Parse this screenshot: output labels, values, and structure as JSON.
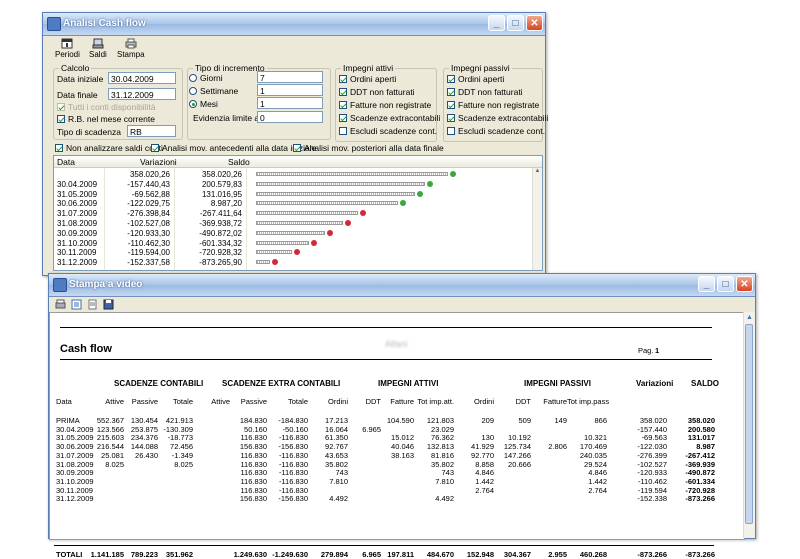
{
  "cashflow_window": {
    "title": "Analisi Cash flow",
    "toolbar": [
      {
        "label": "Periodi",
        "icon": "calendar-icon"
      },
      {
        "label": "Saldi",
        "icon": "scales-icon"
      },
      {
        "label": "Stampa",
        "icon": "printer-icon"
      }
    ],
    "calcolo": {
      "title": "Calcolo",
      "data_iniziale_label": "Data iniziale",
      "data_iniziale": "30.04.2009",
      "data_finale_label": "Data finale",
      "data_finale": "31.12.2009",
      "tutti_conti_label": "Tutti i conti disponibilità",
      "rb_label": "R.B. nel mese corrente",
      "tipo_scadenza_label": "Tipo di scadenza",
      "tipo_scadenza": "RB"
    },
    "incremento": {
      "title": "Tipo di incremento",
      "giorni_label": "Giorni",
      "giorni_value": "7",
      "settimane_label": "Settimane",
      "settimane_value": "1",
      "mesi_label": "Mesi",
      "mesi_value": "1",
      "evidenzia_label": "Evidenzia limite a",
      "evidenzia_value": "0"
    },
    "impegni_attivi": {
      "title": "Impegni attivi",
      "items": [
        {
          "label": "Ordini aperti",
          "checked": true
        },
        {
          "label": "DDT non fatturati",
          "checked": true
        },
        {
          "label": "Fatture non registrate",
          "checked": true
        },
        {
          "label": "Scadenze extracontabili",
          "checked": true
        },
        {
          "label": "Escludi scadenze cont.",
          "checked": false
        }
      ]
    },
    "impegni_passivi": {
      "title": "Impegni passivi",
      "items": [
        {
          "label": "Ordini aperti",
          "checked": true
        },
        {
          "label": "DDT non fatturati",
          "checked": true
        },
        {
          "label": "Fatture non registrate",
          "checked": true
        },
        {
          "label": "Scadenze extracontabili",
          "checked": true
        },
        {
          "label": "Escludi scadenze cont.",
          "checked": false
        }
      ]
    },
    "options": [
      {
        "label": "Non analizzare saldi conti",
        "checked": true
      },
      {
        "label": "Analisi mov. antecedenti alla data iniziale",
        "checked": true
      },
      {
        "label": "Analisi mov. posteriori alla data finale",
        "checked": true
      }
    ],
    "grid": {
      "headers": [
        "Data",
        "Variazioni",
        "Saldo"
      ],
      "rows": [
        {
          "date": "",
          "variazioni": "358.020,26",
          "saldo": "358.020,26",
          "level": 358.02,
          "trend": "up"
        },
        {
          "date": "30.04.2009",
          "variazioni": "-157.440,43",
          "saldo": "200.579,83",
          "level": 200.58,
          "trend": "up"
        },
        {
          "date": "31.05.2009",
          "variazioni": "-69.562,88",
          "saldo": "131.016,95",
          "level": 131.02,
          "trend": "up"
        },
        {
          "date": "30.06.2009",
          "variazioni": "-122.029,75",
          "saldo": "8.987,20",
          "level": 8.99,
          "trend": "up"
        },
        {
          "date": "31.07.2009",
          "variazioni": "-276.398,84",
          "saldo": "-267.411,64",
          "level": -267.41,
          "trend": "down"
        },
        {
          "date": "31.08.2009",
          "variazioni": "-102.527,08",
          "saldo": "-369.938,72",
          "level": -369.94,
          "trend": "down"
        },
        {
          "date": "30.09.2009",
          "variazioni": "-120.933,30",
          "saldo": "-490.872,02",
          "level": -490.87,
          "trend": "down"
        },
        {
          "date": "31.10.2009",
          "variazioni": "-110.462,30",
          "saldo": "-601.334,32",
          "level": -601.33,
          "trend": "down"
        },
        {
          "date": "30.11.2009",
          "variazioni": "-119.594,00",
          "saldo": "-720.928,32",
          "level": -720.93,
          "trend": "down"
        },
        {
          "date": "31.12.2009",
          "variazioni": "-152.337,58",
          "saldo": "-873.265,90",
          "level": -873.27,
          "trend": "down"
        }
      ]
    }
  },
  "print_window": {
    "title": "Stampa a video",
    "toolbar_icons": [
      "print-icon",
      "page-setup-icon",
      "export-icon",
      "save-icon"
    ],
    "report": {
      "title": "Cash flow",
      "company": "Alfani",
      "page_label": "Pag.",
      "page_number": "1",
      "groups": [
        "SCADENZE CONTABILI",
        "SCADENZE EXTRA CONTABILI",
        "IMPEGNI ATTIVI",
        "IMPEGNI PASSIVI",
        "Variazioni",
        "SALDO"
      ],
      "columns": [
        "Data",
        "Attive",
        "Passive",
        "Totale",
        "Attive",
        "Passive",
        "Totale",
        "Ordini",
        "DDT",
        "Fatture",
        "Tot imp.att.",
        "Ordini",
        "DDT",
        "Fatture",
        "Tot imp.pass"
      ],
      "rows": [
        [
          "PRIMA",
          "552.367",
          "130.454",
          "421.913",
          "",
          "184.830",
          "-184.830",
          "17.213",
          "",
          "104.590",
          "121.803",
          "209",
          "509",
          "149",
          "866",
          "358.020",
          "358.020"
        ],
        [
          "30.04.2009",
          "123.566",
          "253.875",
          "-130.309",
          "",
          "50.160",
          "-50.160",
          "16.064",
          "6.965",
          "",
          "23.029",
          "",
          "",
          "",
          "",
          "-157.440",
          "200.580"
        ],
        [
          "31.05.2009",
          "215.603",
          "234.376",
          "-18.773",
          "",
          "116.830",
          "-116.830",
          "61.350",
          "",
          "15.012",
          "76.362",
          "130",
          "10.192",
          "",
          "10.321",
          "-69.563",
          "131.017"
        ],
        [
          "30.06.2009",
          "216.544",
          "144.088",
          "72.456",
          "",
          "156.830",
          "-156.830",
          "92.767",
          "",
          "40.046",
          "132.813",
          "41.929",
          "125.734",
          "2.806",
          "170.469",
          "-122.030",
          "8.987"
        ],
        [
          "31.07.2009",
          "25.081",
          "26.430",
          "-1.349",
          "",
          "116.830",
          "-116.830",
          "43.653",
          "",
          "38.163",
          "81.816",
          "92.770",
          "147.266",
          "",
          "240.035",
          "-276.399",
          "-267.412"
        ],
        [
          "31.08.2009",
          "8.025",
          "",
          "8.025",
          "",
          "116.830",
          "-116.830",
          "35.802",
          "",
          "",
          "35.802",
          "8.858",
          "20.666",
          "",
          "29.524",
          "-102.527",
          "-369.939"
        ],
        [
          "30.09.2009",
          "",
          "",
          "",
          "",
          "116.830",
          "-116.830",
          "743",
          "",
          "",
          "743",
          "4.846",
          "",
          "",
          "4.846",
          "-120.933",
          "-490.872"
        ],
        [
          "31.10.2009",
          "",
          "",
          "",
          "",
          "116.830",
          "-116.830",
          "7.810",
          "",
          "",
          "7.810",
          "1.442",
          "",
          "",
          "1.442",
          "-110.462",
          "-601.334"
        ],
        [
          "30.11.2009",
          "",
          "",
          "",
          "",
          "116.830",
          "-116.830",
          "",
          "",
          "",
          "",
          "2.764",
          "",
          "",
          "2.764",
          "-119.594",
          "-720.928"
        ],
        [
          "31.12.2009",
          "",
          "",
          "",
          "",
          "156.830",
          "-156.830",
          "4.492",
          "",
          "",
          "4.492",
          "",
          "",
          "",
          "",
          "-152.338",
          "-873.266"
        ]
      ],
      "totals": [
        "TOTALI",
        "1.141.185",
        "789.223",
        "351.962",
        "",
        "1.249.630",
        "-1.249.630",
        "279.894",
        "6.965",
        "197.811",
        "484.670",
        "152.948",
        "304.367",
        "2.955",
        "460.268",
        "-873.266",
        "-873.266"
      ]
    }
  }
}
